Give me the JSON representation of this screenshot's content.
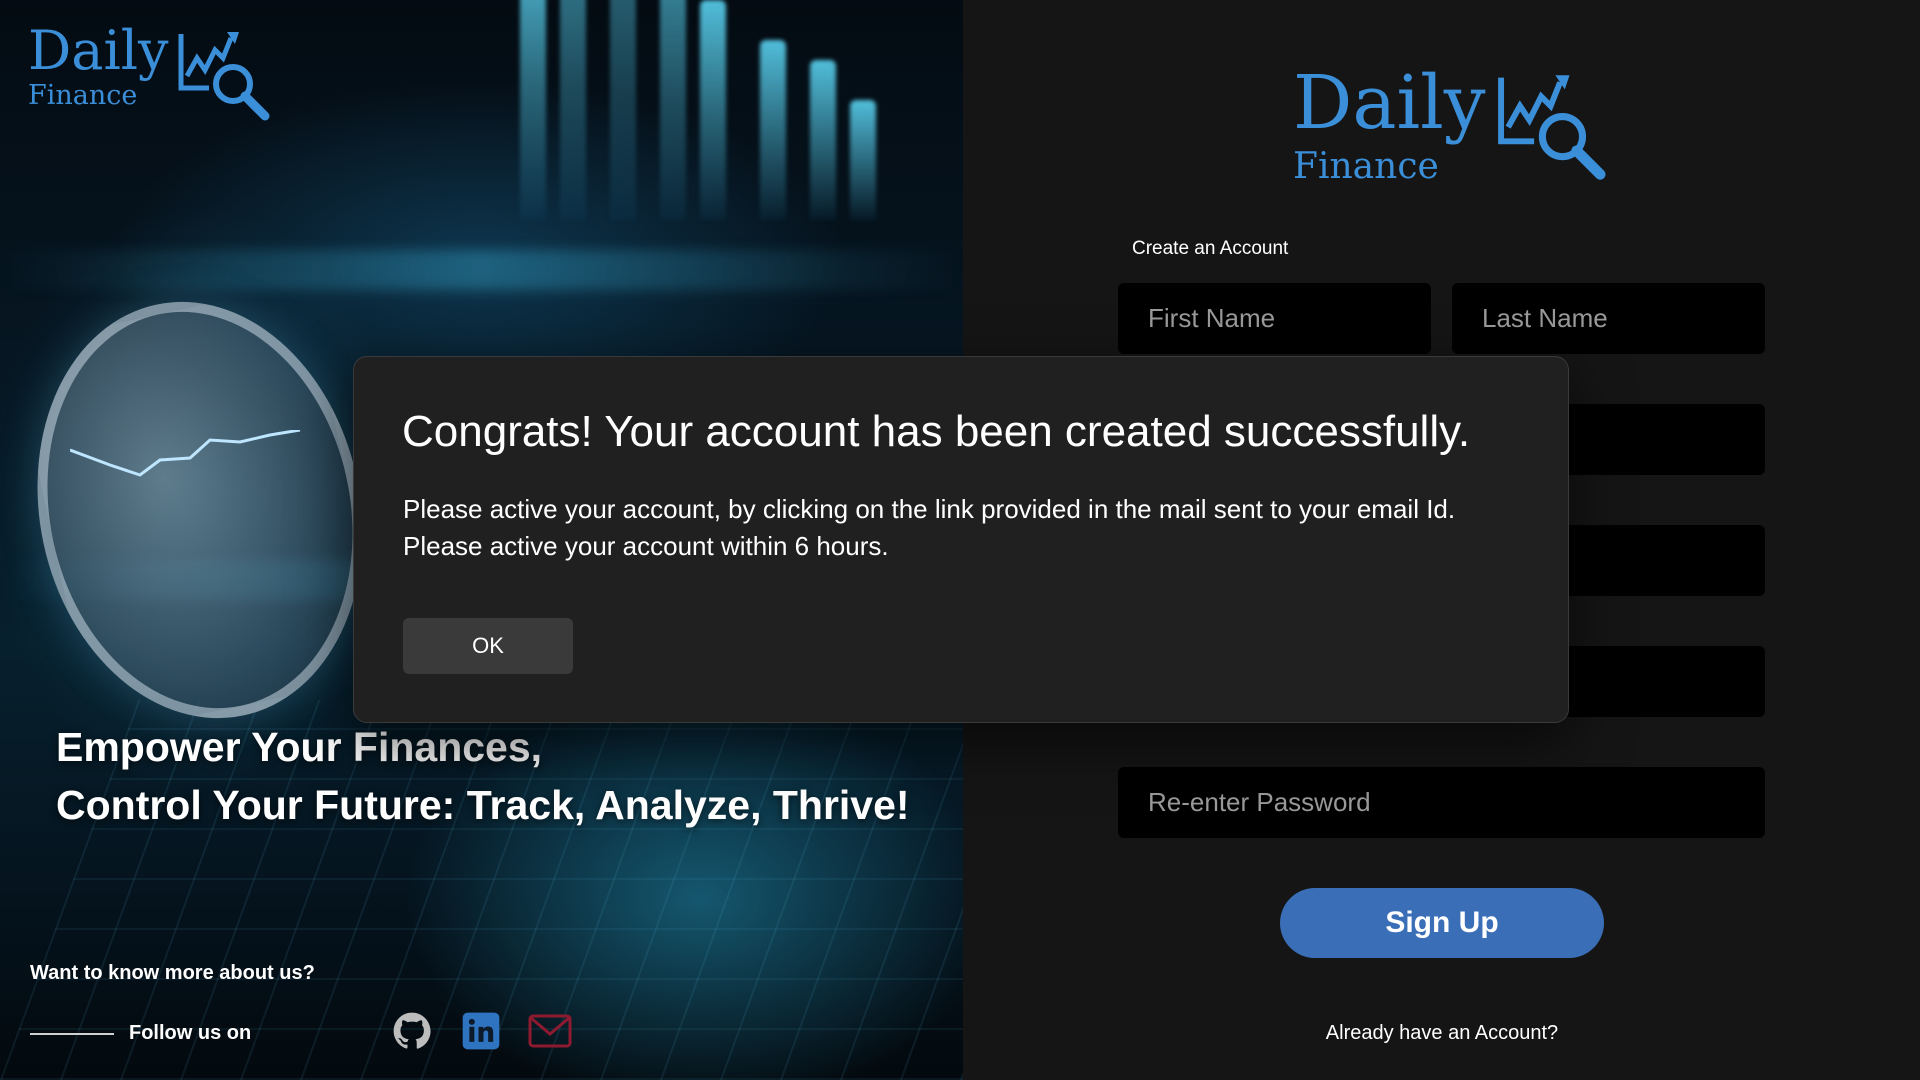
{
  "brand": {
    "name_line1": "Daily",
    "name_line2": "Finance",
    "color": "#3b8fd9"
  },
  "hero": {
    "tagline_line1": "Empower Your Finances,",
    "tagline_line2": "Control Your Future: Track, Analyze, Thrive!",
    "more_text": "Want to know more about us?",
    "follow_text": "Follow us on",
    "social": [
      {
        "name": "github-icon",
        "color": "#bdbdbd"
      },
      {
        "name": "linkedin-icon",
        "color": "#2f74c0"
      },
      {
        "name": "mail-icon",
        "color": "#8e1a30"
      }
    ]
  },
  "form": {
    "title": "Create an Account",
    "first_name_placeholder": "First Name",
    "last_name_placeholder": "Last Name",
    "reenter_password_placeholder": "Re-enter Password",
    "signup_label": "Sign Up",
    "already_text": "Already have an Account?",
    "accent": "#3a6fb8"
  },
  "dialog": {
    "title": "Congrats! Your account has been created successfully.",
    "message_line1": "Please active your account, by clicking on the link provided in the mail sent to your email Id.",
    "message_line2": "Please active your account within 6 hours.",
    "ok_label": "OK"
  }
}
